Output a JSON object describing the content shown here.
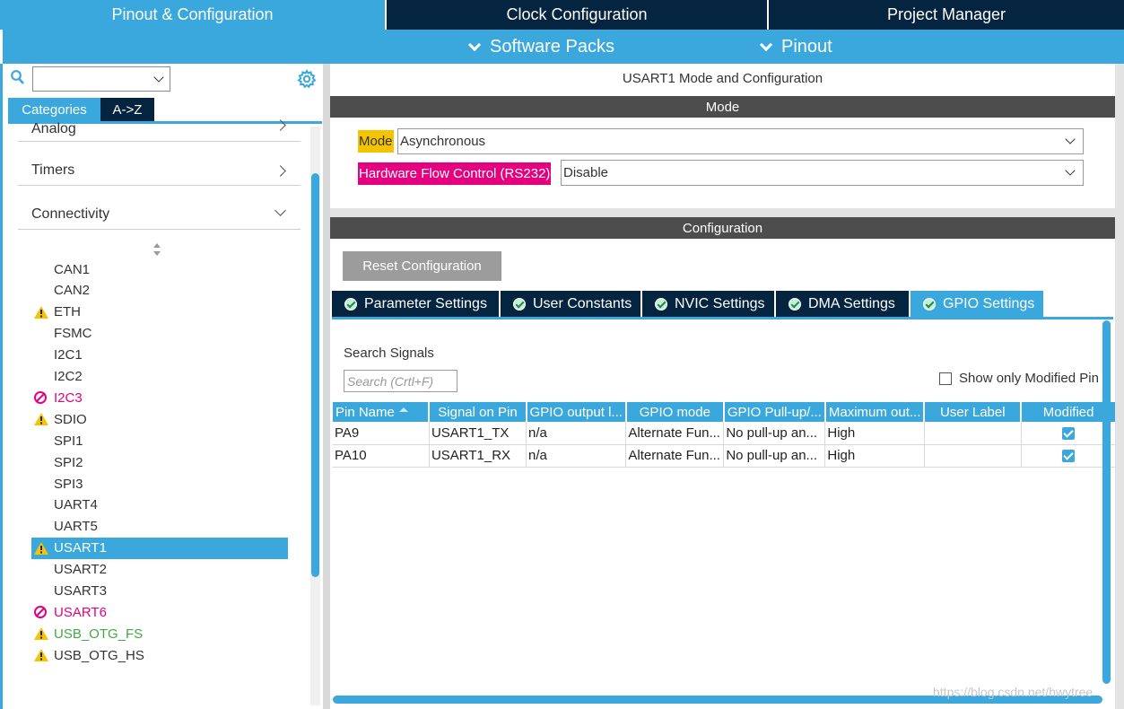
{
  "top_tabs": [
    {
      "label": "Pinout & Configuration",
      "active": true
    },
    {
      "label": "Clock Configuration",
      "active": false
    },
    {
      "label": "Project Manager",
      "active": false
    }
  ],
  "subbar": {
    "software_packs": "Software Packs",
    "pinout": "Pinout"
  },
  "left": {
    "search_value": "",
    "tab_categories": "Categories",
    "tab_az": "A->Z",
    "categories": [
      {
        "label": "Analog",
        "expanded": false
      },
      {
        "label": "Timers",
        "expanded": false
      },
      {
        "label": "Connectivity",
        "expanded": true
      }
    ],
    "peripherals": [
      {
        "label": "CAN1",
        "status": "none"
      },
      {
        "label": "CAN2",
        "status": "none"
      },
      {
        "label": "ETH",
        "status": "warning"
      },
      {
        "label": "FSMC",
        "status": "none"
      },
      {
        "label": "I2C1",
        "status": "none"
      },
      {
        "label": "I2C2",
        "status": "none"
      },
      {
        "label": "I2C3",
        "status": "disabled"
      },
      {
        "label": "SDIO",
        "status": "warning"
      },
      {
        "label": "SPI1",
        "status": "none"
      },
      {
        "label": "SPI2",
        "status": "none"
      },
      {
        "label": "SPI3",
        "status": "none"
      },
      {
        "label": "UART4",
        "status": "none"
      },
      {
        "label": "UART5",
        "status": "none"
      },
      {
        "label": "USART1",
        "status": "warning",
        "selected": true
      },
      {
        "label": "USART2",
        "status": "none"
      },
      {
        "label": "USART3",
        "status": "none"
      },
      {
        "label": "USART6",
        "status": "disabled"
      },
      {
        "label": "USB_OTG_FS",
        "status": "warning-green"
      },
      {
        "label": "USB_OTG_HS",
        "status": "warning"
      }
    ]
  },
  "mode": {
    "title": "USART1 Mode and Configuration",
    "bar": "Mode",
    "mode_label": "Mode",
    "mode_value": "Asynchronous",
    "hfc_label": "Hardware Flow Control (RS232)",
    "hfc_value": "Disable"
  },
  "config": {
    "bar": "Configuration",
    "reset_button": "Reset Configuration",
    "tabs": [
      "Parameter Settings",
      "User Constants",
      "NVIC Settings",
      "DMA Settings",
      "GPIO Settings"
    ],
    "active_tab": "GPIO Settings",
    "search_label": "Search Signals",
    "search_placeholder": "Search (Crtl+F)",
    "show_modified": "Show only Modified Pin",
    "table": {
      "headers": [
        "Pin Name",
        "Signal on Pin",
        "GPIO output l...",
        "GPIO mode",
        "GPIO Pull-up/...",
        "Maximum out...",
        "User Label",
        "Modified"
      ],
      "rows": [
        [
          "PA9",
          "USART1_TX",
          "n/a",
          "Alternate Fun...",
          "No pull-up an...",
          "High",
          "",
          true
        ],
        [
          "PA10",
          "USART1_RX",
          "n/a",
          "Alternate Fun...",
          "No pull-up an...",
          "High",
          "",
          true
        ]
      ]
    }
  },
  "watermark": "https://blog.csdn.net/hwytree",
  "colors": {
    "accent": "#3aa8dc",
    "dark": "#04243f",
    "mode_label": "#f5c400",
    "hfc_label": "#e4007f",
    "disabled": "#e4007f",
    "warning": "#f5c400",
    "green_text": "#3faa3f"
  }
}
